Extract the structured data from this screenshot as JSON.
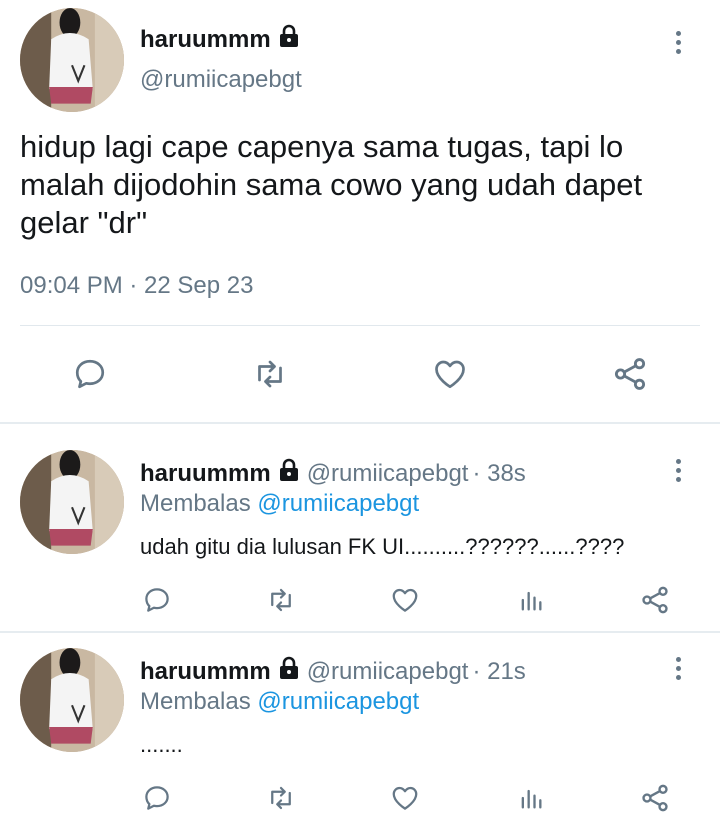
{
  "main_tweet": {
    "display_name": "haruummm",
    "handle": "@rumiicapebgt",
    "text": "hidup lagi cape capenya sama tugas, tapi lo malah dijodohin sama cowo yang udah dapet gelar \"dr\"",
    "timestamp": "09:04 PM · 22 Sep 23",
    "actions": [
      "reply-icon",
      "retweet-icon",
      "like-icon",
      "share-icon"
    ]
  },
  "replies": [
    {
      "display_name": "haruummm",
      "handle": "@rumiicapebgt",
      "age": "· 38s",
      "replying_prefix": "Membalas",
      "replying_to": "@rumiicapebgt",
      "text": "udah gitu dia lulusan FK UI..........??????......????",
      "actions": [
        "reply-icon",
        "retweet-icon",
        "like-icon",
        "analytics-icon",
        "share-icon"
      ]
    },
    {
      "display_name": "haruummm",
      "handle": "@rumiicapebgt",
      "age": "· 21s",
      "replying_prefix": "Membalas",
      "replying_to": "@rumiicapebgt",
      "text": ".......",
      "actions": [
        "reply-icon",
        "retweet-icon",
        "like-icon",
        "analytics-icon",
        "share-icon"
      ]
    }
  ],
  "colors": {
    "text": "#14171a",
    "muted": "#657786",
    "link": "#1b95e0",
    "divider": "#e1e8ed"
  }
}
